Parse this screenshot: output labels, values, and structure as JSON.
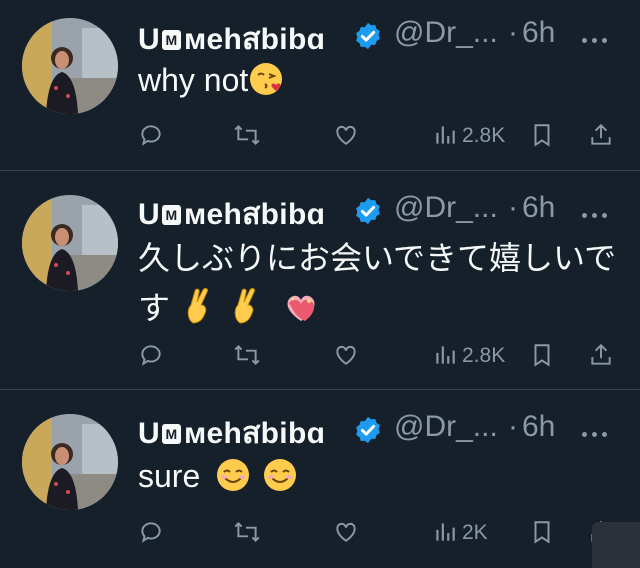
{
  "tweets": [
    {
      "display_name": "U",
      "name_badge": "M",
      "name_rest": "мehสbibɑ",
      "handle": "@Dr_...",
      "dot": "·",
      "time": "6h",
      "text": "why not",
      "emojis": [
        "face-blowing-kiss"
      ],
      "views": "2.8K"
    },
    {
      "display_name": "U",
      "name_badge": "M",
      "name_rest": "мehสbibɑ",
      "handle": "@Dr_...",
      "dot": "·",
      "time": "6h",
      "text_line1": "久しぶりにお会いできて嬉しいで",
      "text_line2": "す",
      "emojis": [
        "crossed-fingers",
        "crossed-fingers",
        "heart-with-ribbon"
      ],
      "views": "2.8K"
    },
    {
      "display_name": "U",
      "name_badge": "M",
      "name_rest": "мehสbibɑ",
      "handle": "@Dr_...",
      "dot": "·",
      "time": "6h",
      "text": "sure",
      "emojis": [
        "smiling-face",
        "smiling-face"
      ],
      "views": "2K"
    }
  ],
  "colors": {
    "background": "#15202b",
    "text": "#f7f9f9",
    "secondary": "#8b98a5",
    "verified": "#1d9bf0",
    "separator": "#38444d"
  }
}
